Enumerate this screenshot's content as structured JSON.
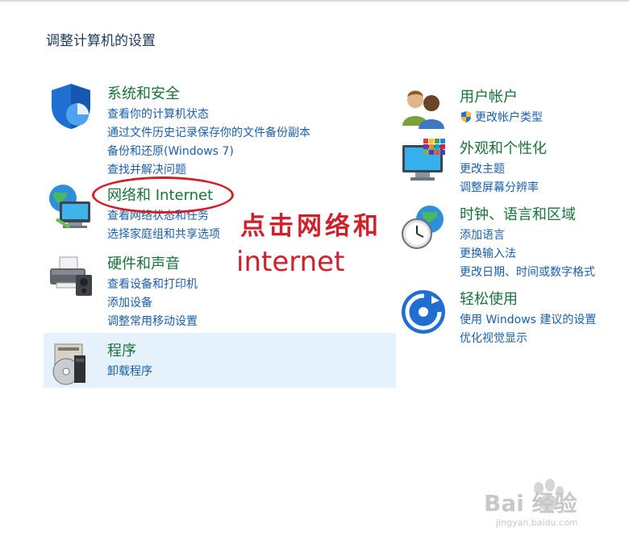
{
  "page_title": "调整计算机的设置",
  "categories_left": [
    {
      "title": "系统和安全",
      "icon": "shield-icon",
      "links": [
        "查看你的计算机状态",
        "通过文件历史记录保存你的文件备份副本",
        "备份和还原(Windows 7)",
        "查找并解决问题"
      ]
    },
    {
      "title": "网络和 Internet",
      "icon": "network-globe-icon",
      "links": [
        "查看网络状态和任务",
        "选择家庭组和共享选项"
      ]
    },
    {
      "title": "硬件和声音",
      "icon": "printer-icon",
      "links": [
        "查看设备和打印机",
        "添加设备",
        "调整常用移动设置"
      ]
    },
    {
      "title": "程序",
      "icon": "programs-disc-icon",
      "links": [
        "卸载程序"
      ]
    }
  ],
  "categories_right": [
    {
      "title": "用户帐户",
      "icon": "users-icon",
      "links": [
        "更改帐户类型"
      ]
    },
    {
      "title": "外观和个性化",
      "icon": "monitor-colors-icon",
      "links": [
        "更改主题",
        "调整屏幕分辨率"
      ]
    },
    {
      "title": "时钟、语言和区域",
      "icon": "clock-globe-icon",
      "links": [
        "添加语言",
        "更换输入法",
        "更改日期、时间或数字格式"
      ]
    },
    {
      "title": "轻松使用",
      "icon": "ease-of-access-icon",
      "links": [
        "使用 Windows 建议的设置",
        "优化视觉显示"
      ]
    }
  ],
  "annotation": {
    "line1": "点击网络和",
    "line2": "internet",
    "color": "#d0202a"
  },
  "watermark": {
    "text": "Bai 经验",
    "url": "jingyan.baidu.com"
  },
  "colors": {
    "category_title": "#18733a",
    "link": "#1a5fae",
    "highlight": "#e5f1fb"
  }
}
